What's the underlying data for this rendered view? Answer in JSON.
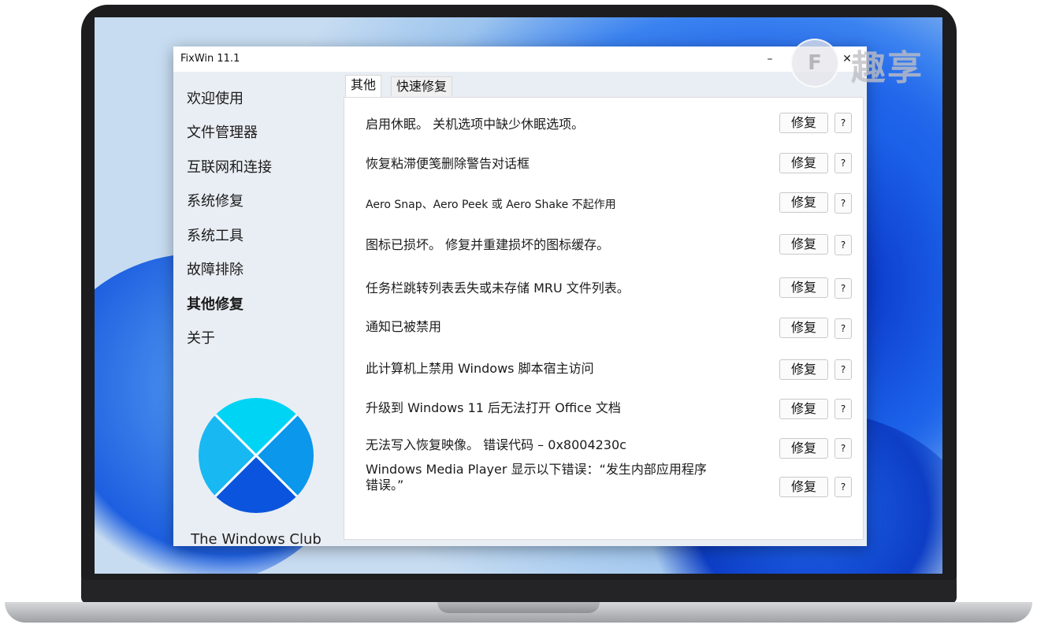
{
  "window": {
    "title": "FixWin 11.1",
    "minimize_icon": "minimize-icon",
    "close_icon": "close-icon"
  },
  "watermark": {
    "logo_char": "F",
    "text": "趣享"
  },
  "sidebar": {
    "items": [
      {
        "label": "欢迎使用"
      },
      {
        "label": "文件管理器"
      },
      {
        "label": "互联网和连接"
      },
      {
        "label": "系统修复"
      },
      {
        "label": "系统工具"
      },
      {
        "label": "故障排除"
      },
      {
        "label": "其他修复",
        "active": true
      },
      {
        "label": "关于"
      }
    ],
    "footer": "The Windows Club"
  },
  "tabs": [
    {
      "label": "其他",
      "active": true
    },
    {
      "label": "快速修复",
      "active": false
    }
  ],
  "fixes": {
    "button_label": "修复",
    "help_label": "?",
    "rows": [
      {
        "label": "启用休眠。 关机选项中缺少休眠选项。"
      },
      {
        "label": "恢复粘滞便笺删除警告对话框"
      },
      {
        "label": "Aero Snap、Aero Peek 或 Aero Shake 不起作用"
      },
      {
        "label": "图标已损坏。 修复并重建损坏的图标缓存。"
      },
      {
        "label": "任务栏跳转列表丢失或未存储 MRU 文件列表。"
      },
      {
        "label": "通知已被禁用"
      },
      {
        "label": "此计算机上禁用 Windows 脚本宿主访问"
      },
      {
        "label": "升级到 Windows 11 后无法打开 Office 文档"
      },
      {
        "label": "无法写入恢复映像。 错误代码 – 0x8004230c"
      },
      {
        "label": "Windows Media Player 显示以下错误：“发生内部应用程序错误。”"
      }
    ]
  },
  "colors": {
    "sidebar_bg": "#e9eef4",
    "logo_top": "#00d4f5",
    "logo_left": "#18b8f2",
    "logo_right": "#0a97ec",
    "logo_bottom": "#0b55de"
  }
}
